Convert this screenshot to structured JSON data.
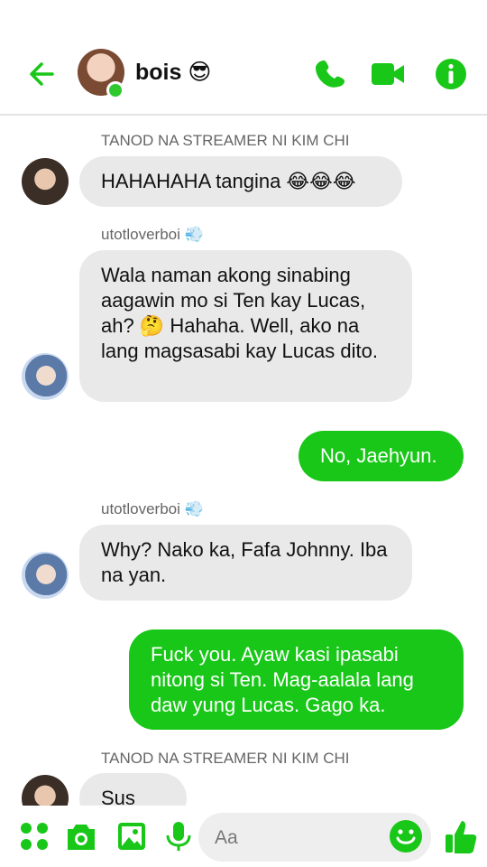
{
  "header": {
    "title": "bois 😎",
    "back_icon": "arrow-left-icon",
    "call_icon": "phone-icon",
    "video_icon": "video-icon",
    "info_icon": "info-icon",
    "accent": "#18c718"
  },
  "messages": [
    {
      "sender": "TANOD NA STREAMER NI KIM CHI",
      "text": "HAHAHAHA tangina 😂😂😂",
      "direction": "in"
    },
    {
      "sender": "utotloverboi 💨",
      "text": "Wala naman akong sinabing aagawin mo si Ten kay Lucas, ah? 🤔 Hahaha. Well, ako na lang magsasabi kay Lucas dito.",
      "direction": "in"
    },
    {
      "sender": "",
      "text": "No, Jaehyun.",
      "direction": "out"
    },
    {
      "sender": "utotloverboi 💨",
      "text": "Why? Nako ka, Fafa Johnny. Iba na yan.",
      "direction": "in"
    },
    {
      "sender": "",
      "text": "Fuck you. Ayaw kasi ipasabi nitong si Ten. Mag-aalala lang daw yung Lucas. Gago ka.",
      "direction": "out"
    },
    {
      "sender": "TANOD NA STREAMER NI KIM CHI",
      "text": "Sus 🙄",
      "direction": "in"
    }
  ],
  "composer": {
    "placeholder": "Aa",
    "icons": [
      "apps-icon",
      "camera-icon",
      "image-icon",
      "mic-icon",
      "emoji-icon",
      "like-icon"
    ]
  }
}
